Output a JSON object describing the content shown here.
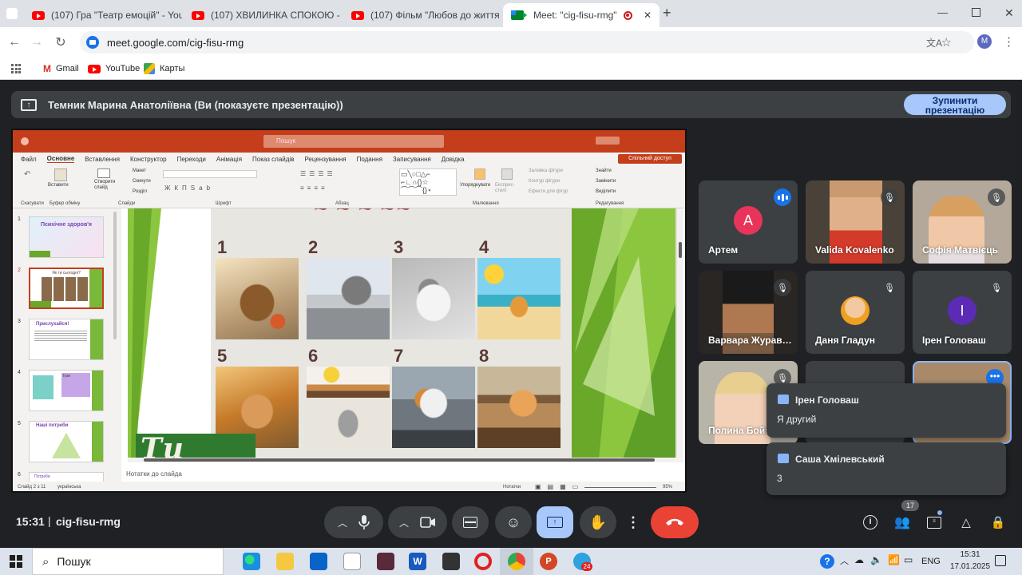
{
  "browser": {
    "tabs": [
      {
        "title": "(107) Гра \"Театр емоцій\" - You",
        "active": false
      },
      {
        "title": "(107) ХВИЛИНКА СПОКОЮ - Y",
        "active": false
      },
      {
        "title": "(107) Фільм \"Любов до життя\"",
        "active": false
      },
      {
        "title": "Meet: \"cig-fisu-rmg\"",
        "active": true
      }
    ],
    "url": "meet.google.com/cig-fisu-rmg",
    "profile_initial": "M",
    "bookmarks": [
      "Gmail",
      "YouTube",
      "Карты"
    ]
  },
  "meet": {
    "presenting_label": "Темник Марина Анатоліївна (Ви (показуєте презентацію))",
    "stop_label": "Зупинити презентацію",
    "meeting_time": "15:31",
    "meeting_code": "cig-fisu-rmg",
    "participant_count": "17",
    "participants": [
      {
        "name": "Артем",
        "initial": "A",
        "avatar_color": "#e8345b",
        "speaking": true
      },
      {
        "name": "Valida Kovalenko",
        "video": true,
        "muted": true
      },
      {
        "name": "Софія Матвієць",
        "video": true,
        "muted": true
      },
      {
        "name": "Варвара Журав…",
        "video": true,
        "muted": true
      },
      {
        "name": "Даня Гладун",
        "video": true,
        "muted": true
      },
      {
        "name": "Ірен Головаш",
        "initial": "І",
        "avatar_color": "#5b2bb5",
        "muted": true
      },
      {
        "name": "Полина Бойк",
        "video": true,
        "muted": true
      }
    ],
    "chat_messages": [
      {
        "author": "Ірен Головаш",
        "text": "Я другий"
      },
      {
        "author": "Саша Хмілевський",
        "text": "3"
      }
    ]
  },
  "ppt": {
    "search_placeholder": "Пошук",
    "menu": [
      "Файл",
      "Основне",
      "Вставлення",
      "Конструктор",
      "Переходи",
      "Анімація",
      "Показ слайдів",
      "Рецензування",
      "Подання",
      "Записування",
      "Довідка"
    ],
    "share_label": "Спільний доступ",
    "ribbon_groups": [
      "Скасувати",
      "Буфер обміну",
      "Слайди",
      "Шрифт",
      "Абзац",
      "Малювання",
      "Редагування"
    ],
    "ribbon_items": [
      "Вставити",
      "Створити слайд",
      "Макет",
      "Скинути",
      "Розділ",
      "Упорядкувати",
      "Експрес-стилі",
      "Заливка фігури",
      "Контур фігури",
      "Ефекти для фігур",
      "Знайти",
      "Замінити",
      "Виділити"
    ],
    "slide_numbers": [
      "1",
      "2",
      "3",
      "4",
      "5",
      "6",
      "7",
      "8"
    ],
    "slide_caption": "Ти як?",
    "thumb_titles": [
      "Психічне здоров'я",
      "Як ти сьогодні?",
      "Прислухайся!",
      "Ігри",
      "Наші потреби",
      "Потреби"
    ],
    "notes_placeholder": "Нотатки до слайда",
    "status_slide": "Слайд 2 з 11",
    "status_lang": "українська",
    "status_notes": "Нотатки",
    "zoom": "95%"
  },
  "taskbar": {
    "search_placeholder": "Пошук",
    "language": "ENG",
    "time": "15:31",
    "date": "17.01.2025",
    "badge": "24"
  }
}
